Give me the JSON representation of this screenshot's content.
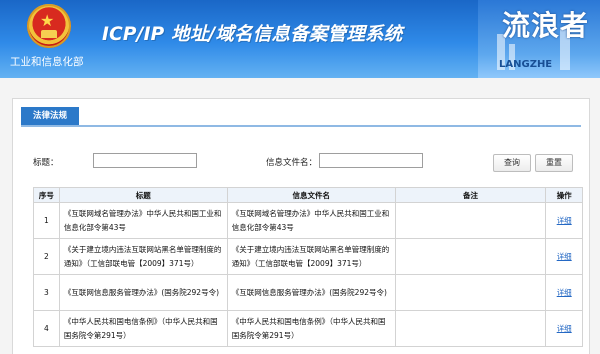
{
  "header": {
    "ministry": "工业和信息化部",
    "title": "ICP/IP 地址/域名信息备案管理系统",
    "brand": "流浪者",
    "brand_mark": "LANGZHE"
  },
  "section": {
    "tab": "法律法规"
  },
  "search": {
    "title_label": "标题：",
    "file_label": "信息文件名：",
    "query_button": "查询",
    "reset_button": "重置"
  },
  "table": {
    "columns": [
      "序号",
      "标题",
      "信息文件名",
      "备注",
      "操作"
    ],
    "rows": [
      {
        "no": "1",
        "title": "《互联网域名管理办法》中华人民共和国工业和信息化部令第43号",
        "file": "《互联网域名管理办法》中华人民共和国工业和信息化部令第43号",
        "note": "",
        "action": "详细"
      },
      {
        "no": "2",
        "title": "《关于建立境内违法互联网站黑名单管理制度的通知》（工信部联电管【2009】371号）",
        "file": "《关于建立境内违法互联网站黑名单管理制度的通知》（工信部联电管【2009】371号）",
        "note": "",
        "action": "详细"
      },
      {
        "no": "3",
        "title": "《互联网信息服务管理办法》(国务院292号令)",
        "file": "《互联网信息服务管理办法》(国务院292号令)",
        "note": "",
        "action": "详细"
      },
      {
        "no": "4",
        "title": "《中华人民共和国电信条例》（中华人民共和国国务院令第291号）",
        "file": "《中华人民共和国电信条例》（中华人民共和国国务院令第291号）",
        "note": "",
        "action": "详细"
      }
    ]
  }
}
